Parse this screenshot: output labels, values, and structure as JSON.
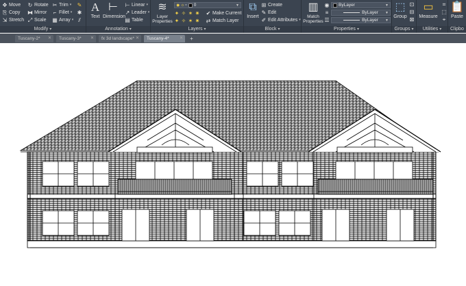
{
  "ribbon": {
    "modify": {
      "title": "Modify",
      "move": "Move",
      "rotate": "Rotate",
      "trim": "Trim",
      "copy": "Copy",
      "mirror": "Mirror",
      "fillet": "Fillet",
      "stretch": "Stretch",
      "scale": "Scale",
      "array": "Array"
    },
    "annotation": {
      "title": "Annotation",
      "text": "Text",
      "dimension": "Dimension",
      "linear": "Linear",
      "leader": "Leader",
      "table": "Table"
    },
    "layers": {
      "title": "Layers",
      "layer_properties": "Layer Properties",
      "layer_value": "0",
      "make_current": "Make Current",
      "match_layer": "Match Layer"
    },
    "block": {
      "title": "Block",
      "insert": "Insert",
      "create": "Create",
      "edit": "Edit",
      "edit_attributes": "Edit Attributes"
    },
    "properties": {
      "title": "Properties",
      "match_properties": "Match Properties",
      "color_value": "ByLayer",
      "linetype_value": "ByLayer",
      "lineweight_value": "ByLayer"
    },
    "groups": {
      "title": "Groups",
      "group": "Group"
    },
    "utilities": {
      "title": "Utilities",
      "measure": "Measure"
    },
    "clipboard": {
      "title": "Clipbo",
      "paste": "Paste"
    }
  },
  "tabs": [
    {
      "label": "Tuscany-2*"
    },
    {
      "label": "Tuscany-3*"
    },
    {
      "label": "fx 3d landscape*"
    },
    {
      "label": "Tuscany-4*",
      "active": true
    }
  ],
  "colors": {
    "ribbon_bg": "#3b4450",
    "tab_active": "#7a828d",
    "canvas_bg": "#ffffff",
    "drawing_line": "#000000"
  }
}
